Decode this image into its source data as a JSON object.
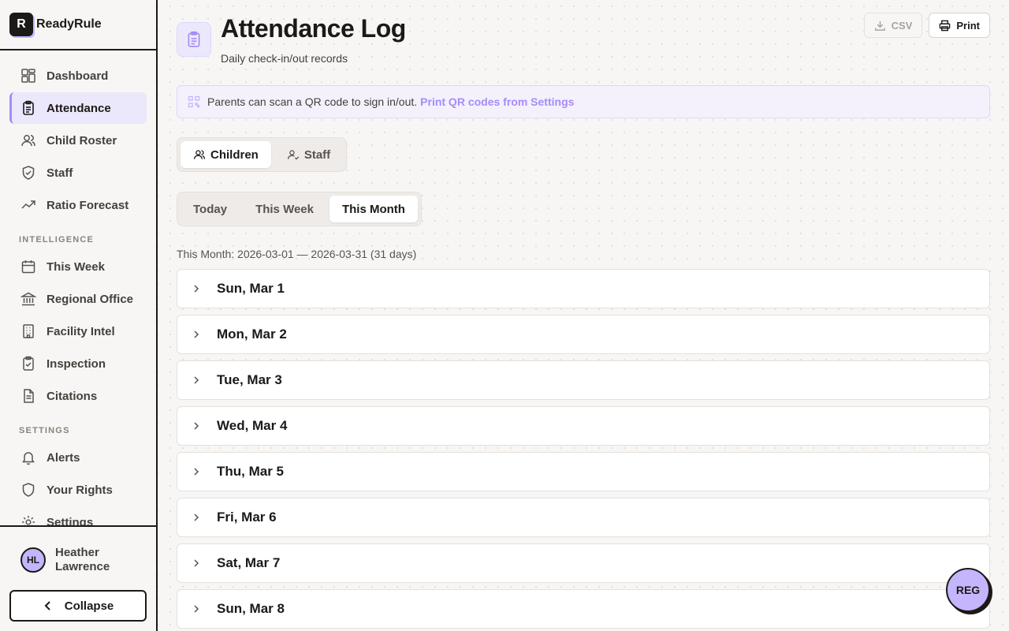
{
  "app": {
    "name": "ReadyRule",
    "logo_letter": "R"
  },
  "sidebar": {
    "items": [
      {
        "label": "Dashboard",
        "icon": "dashboard-icon"
      },
      {
        "label": "Attendance",
        "icon": "clipboard-icon",
        "active": true
      },
      {
        "label": "Child Roster",
        "icon": "users-icon"
      },
      {
        "label": "Staff",
        "icon": "shield-check-icon"
      },
      {
        "label": "Ratio Forecast",
        "icon": "trending-up-icon"
      }
    ],
    "intelligence_label": "INTELLIGENCE",
    "intelligence_items": [
      {
        "label": "This Week",
        "icon": "calendar-icon"
      },
      {
        "label": "Regional Office",
        "icon": "bank-icon"
      },
      {
        "label": "Facility Intel",
        "icon": "building-icon"
      },
      {
        "label": "Inspection",
        "icon": "clipboard-check-icon"
      },
      {
        "label": "Citations",
        "icon": "document-icon"
      }
    ],
    "settings_label": "SETTINGS",
    "settings_items": [
      {
        "label": "Alerts",
        "icon": "bell-icon"
      },
      {
        "label": "Your Rights",
        "icon": "shield-icon"
      },
      {
        "label": "Settings",
        "icon": "gear-icon"
      }
    ],
    "user": {
      "initials": "HL",
      "name": "Heather Lawrence"
    },
    "collapse_label": "Collapse"
  },
  "header": {
    "title": "Attendance Log",
    "subtitle": "Daily check-in/out records",
    "csv_label": "CSV",
    "print_label": "Print"
  },
  "notice": {
    "text": "Parents can scan a QR code to sign in/out.",
    "link": "Print QR codes from Settings"
  },
  "people_tabs": [
    {
      "label": "Children",
      "icon": "users-icon",
      "active": true
    },
    {
      "label": "Staff",
      "icon": "user-check-icon",
      "active": false
    }
  ],
  "period_tabs": [
    {
      "label": "Today",
      "active": false
    },
    {
      "label": "This Week",
      "active": false
    },
    {
      "label": "This Month",
      "active": true
    }
  ],
  "range_text": "This Month: 2026-03-01 — 2026-03-31 (31 days)",
  "days": [
    "Sun, Mar 1",
    "Mon, Mar 2",
    "Tue, Mar 3",
    "Wed, Mar 4",
    "Thu, Mar 5",
    "Fri, Mar 6",
    "Sat, Mar 7",
    "Sun, Mar 8"
  ],
  "fab_label": "REG",
  "colors": {
    "accent": "#a78bfa",
    "accent_light": "#c4b5fd",
    "border": "#1c1917"
  }
}
